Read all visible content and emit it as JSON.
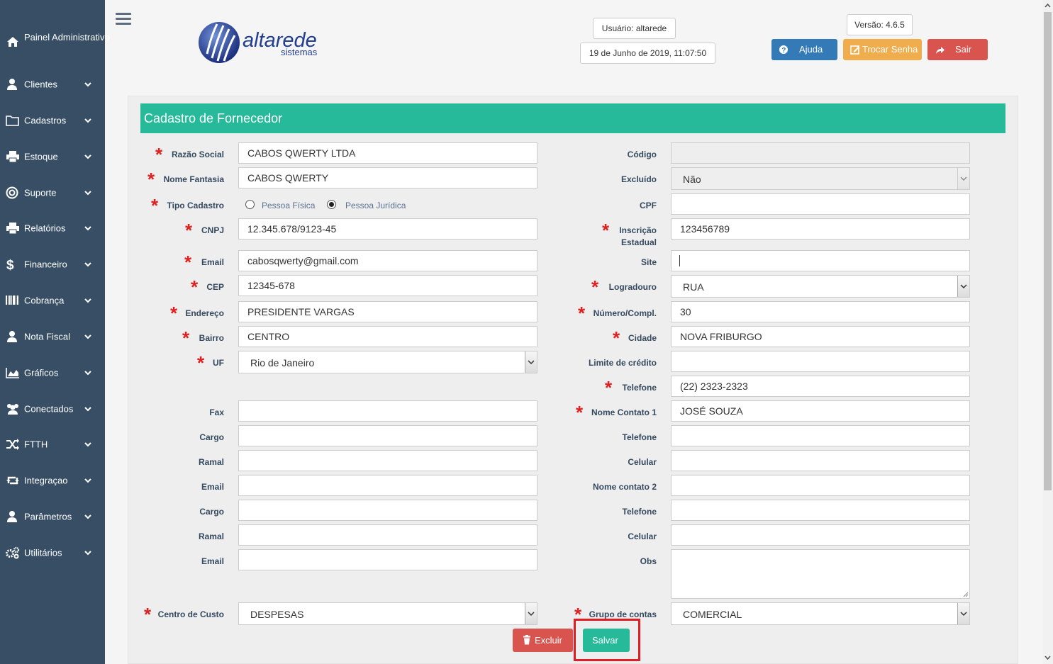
{
  "sidebar": {
    "items": [
      {
        "label": "Painel Administrativo",
        "icon": "home-icon"
      },
      {
        "label": "Clientes",
        "icon": "user-icon"
      },
      {
        "label": "Cadastros",
        "icon": "folder-icon"
      },
      {
        "label": "Estoque",
        "icon": "print-icon"
      },
      {
        "label": "Suporte",
        "icon": "lifebuoy-icon"
      },
      {
        "label": "Relatórios",
        "icon": "print-icon"
      },
      {
        "label": "Financeiro",
        "icon": "dollar-icon"
      },
      {
        "label": "Cobrança",
        "icon": "barcode-icon"
      },
      {
        "label": "Nota Fiscal",
        "icon": "user-icon"
      },
      {
        "label": "Gráficos",
        "icon": "area-chart-icon"
      },
      {
        "label": "Conectados",
        "icon": "users-icon"
      },
      {
        "label": "FTTH",
        "icon": "random-icon"
      },
      {
        "label": "Integraçao",
        "icon": "retweet-icon"
      },
      {
        "label": "Parâmetros",
        "icon": "user-icon"
      },
      {
        "label": "Utilitários",
        "icon": "cogs-icon"
      }
    ]
  },
  "header": {
    "logo_text": "altarede",
    "logo_sub": "sistemas",
    "user": "Usuário: altarede",
    "datetime": "19 de Junho de 2019, 11:07:50",
    "version": "Versão: 4.6.5",
    "help_label": "Ajuda",
    "change_password_label": "Trocar Senha",
    "logout_label": "Sair",
    "colors": {
      "help": "#337ab7",
      "change_password": "#f0ad4e",
      "logout": "#d9534f"
    }
  },
  "form": {
    "title": "Cadastro de Fornecedor",
    "accent": "#26b99a",
    "left": {
      "razao_social": {
        "label": "Razão Social",
        "value": "CABOS QWERTY LTDA"
      },
      "nome_fantasia": {
        "label": "Nome Fantasia",
        "value": "CABOS QWERTY"
      },
      "tipo_cadastro": {
        "label": "Tipo Cadastro",
        "options": [
          "Pessoa Física",
          "Pessoa Jurídica"
        ],
        "selected": "Pessoa Jurídica"
      },
      "cnpj": {
        "label": "CNPJ",
        "value": "12.345.678/9123-45"
      },
      "email": {
        "label": "Email",
        "value": "cabosqwerty@gmail.com"
      },
      "cep": {
        "label": "CEP",
        "value": "12345-678"
      },
      "endereco": {
        "label": "Endereço",
        "value": "PRESIDENTE VARGAS"
      },
      "bairro": {
        "label": "Bairro",
        "value": "CENTRO"
      },
      "uf": {
        "label": "UF",
        "value": "Rio de Janeiro"
      },
      "fax": {
        "label": "Fax",
        "value": ""
      },
      "cargo1": {
        "label": "Cargo",
        "value": ""
      },
      "ramal1": {
        "label": "Ramal",
        "value": ""
      },
      "email1": {
        "label": "Email",
        "value": ""
      },
      "cargo2": {
        "label": "Cargo",
        "value": ""
      },
      "ramal2": {
        "label": "Ramal",
        "value": ""
      },
      "email2": {
        "label": "Email",
        "value": ""
      },
      "centro_custo": {
        "label": "Centro de Custo",
        "value": "DESPESAS"
      }
    },
    "right": {
      "codigo": {
        "label": "Código",
        "value": ""
      },
      "excluido": {
        "label": "Excluído",
        "value": "Não"
      },
      "cpf": {
        "label": "CPF",
        "value": ""
      },
      "inscricao_estadual": {
        "label1": "Inscrição",
        "label2": "Estadual",
        "value": "123456789"
      },
      "site": {
        "label": "Site",
        "value": ""
      },
      "logradouro": {
        "label": "Logradouro",
        "value": "RUA"
      },
      "numero": {
        "label": "Número/Compl.",
        "value": "30"
      },
      "cidade": {
        "label": "Cidade",
        "value": "NOVA FRIBURGO"
      },
      "limite_credito": {
        "label": "Limite de crédito",
        "value": ""
      },
      "telefone": {
        "label": "Telefone",
        "value": "(22) 2323-2323"
      },
      "nome_contato1": {
        "label": "Nome Contato 1",
        "value": "JOSÉ SOUZA"
      },
      "telefone1": {
        "label": "Telefone",
        "value": ""
      },
      "celular1": {
        "label": "Celular",
        "value": ""
      },
      "nome_contato2": {
        "label": "Nome contato 2",
        "value": ""
      },
      "telefone2": {
        "label": "Telefone",
        "value": ""
      },
      "celular2": {
        "label": "Celular",
        "value": ""
      },
      "obs": {
        "label": "Obs",
        "value": ""
      },
      "grupo_contas": {
        "label": "Grupo de contas",
        "value": "COMERCIAL"
      }
    },
    "actions": {
      "delete_label": "Excluir",
      "save_label": "Salvar",
      "colors": {
        "delete": "#d9534f",
        "save": "#26b99a",
        "highlight": "#e31b23"
      }
    }
  }
}
